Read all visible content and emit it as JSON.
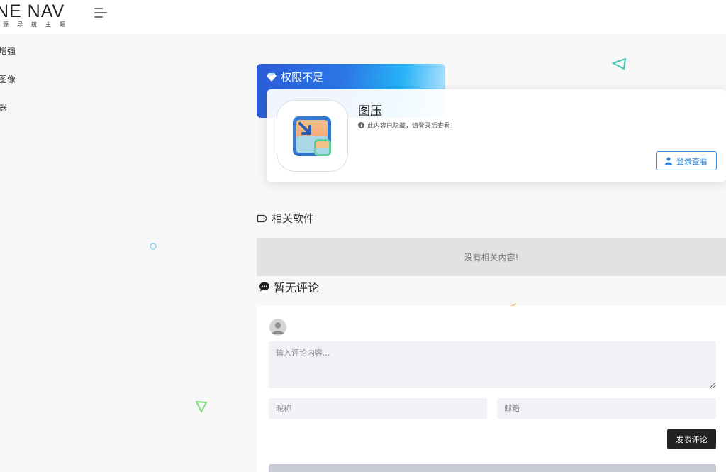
{
  "header": {
    "logo_text": "NE NAV",
    "logo_subtext": "源导航主题"
  },
  "sidebar": {
    "items": [
      {
        "label": "增强"
      },
      {
        "label": "图像"
      },
      {
        "label": "器"
      }
    ]
  },
  "banner": {
    "title": "权限不足",
    "icon": "diamond-icon"
  },
  "app": {
    "name": "图压",
    "hidden_notice": "此内容已隐藏，请登录后查看！",
    "login_button": "登录查看",
    "icon": "image-compress-app-icon"
  },
  "related": {
    "title": "相关软件",
    "empty_message": "没有相关内容!",
    "icon": "tag-icon"
  },
  "comments": {
    "title": "暂无评论",
    "icon": "chat-bubble-icon",
    "textarea_placeholder": "输入评论内容...",
    "nickname_placeholder": "昵称",
    "email_placeholder": "邮箱",
    "submit_label": "发表评论"
  },
  "colors": {
    "banner_gradient_start": "#2c5bd8",
    "banner_gradient_end": "#27b3f6",
    "login_accent": "#2f86d8",
    "submit_bg": "#222222",
    "empty_bg": "#e2e2e2",
    "input_bg": "#f1f2f6"
  }
}
